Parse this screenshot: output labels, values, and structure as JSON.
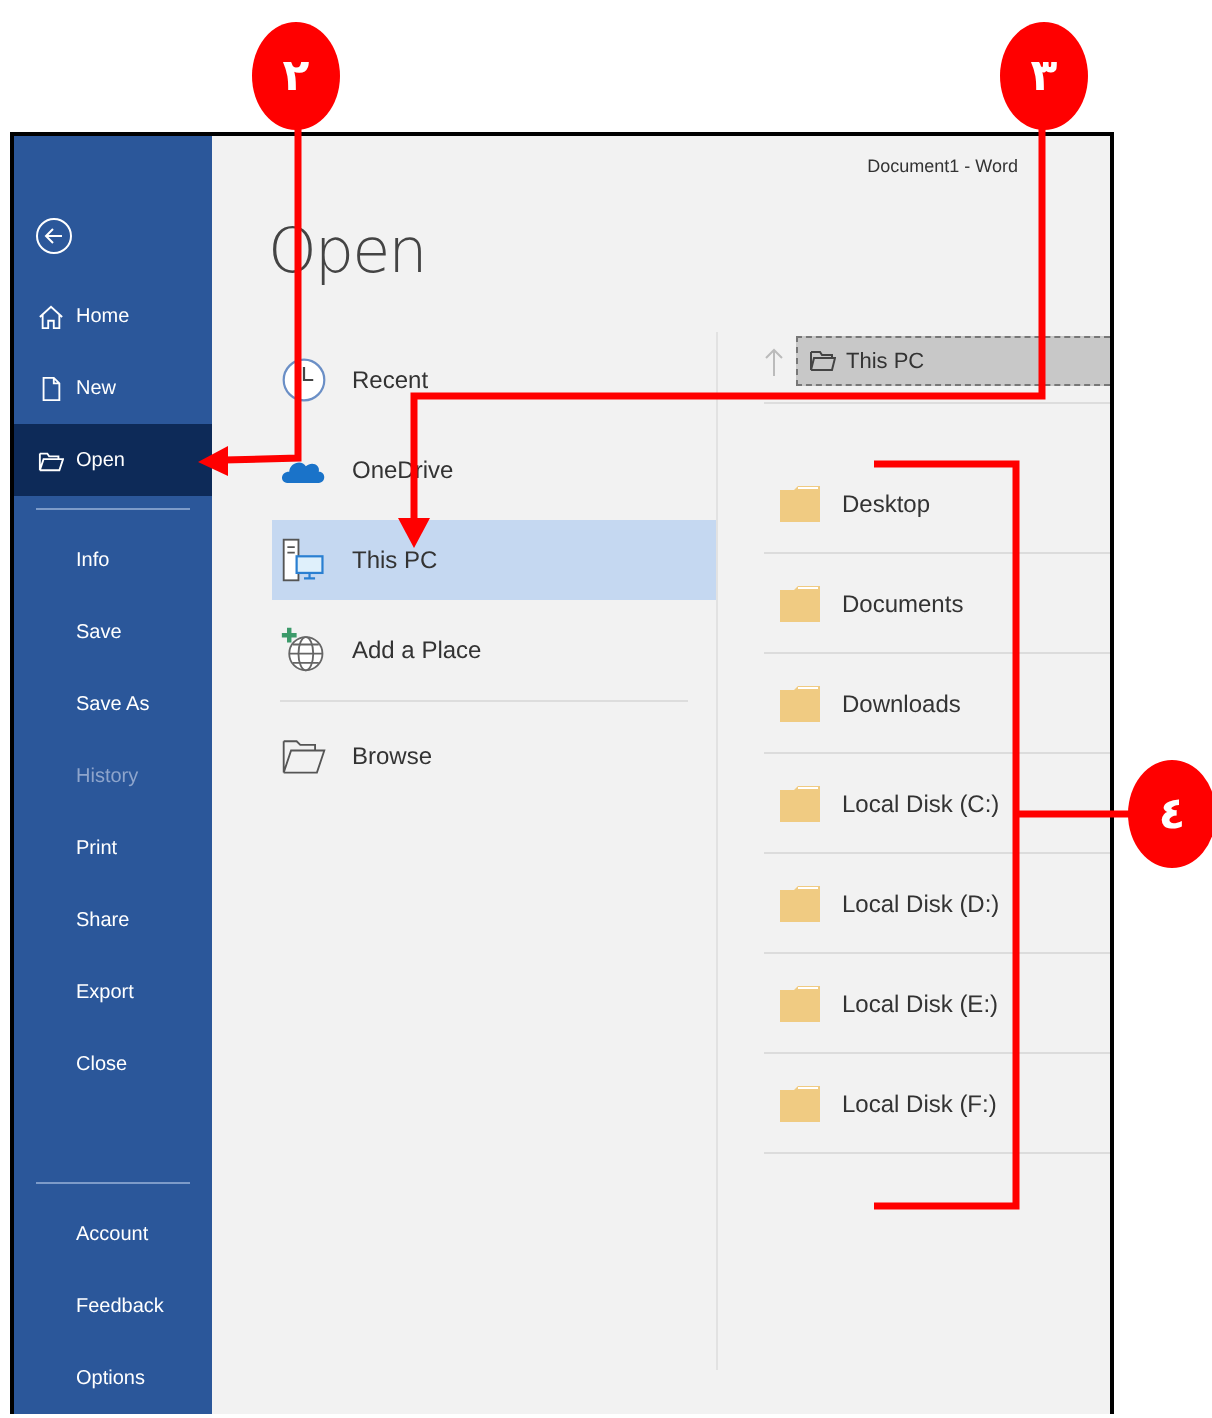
{
  "window": {
    "title": "Document1 - Word"
  },
  "sidebar": {
    "top_items": [
      {
        "label": "Home",
        "kind": "home",
        "selected": false,
        "disabled": false
      },
      {
        "label": "New",
        "kind": "new",
        "selected": false,
        "disabled": false
      },
      {
        "label": "Open",
        "kind": "open",
        "selected": true,
        "disabled": false
      }
    ],
    "middle_items": [
      {
        "label": "Info",
        "kind": "plain",
        "selected": false,
        "disabled": false
      },
      {
        "label": "Save",
        "kind": "plain",
        "selected": false,
        "disabled": false
      },
      {
        "label": "Save As",
        "kind": "plain",
        "selected": false,
        "disabled": false
      },
      {
        "label": "History",
        "kind": "plain",
        "selected": false,
        "disabled": true
      },
      {
        "label": "Print",
        "kind": "plain",
        "selected": false,
        "disabled": false
      },
      {
        "label": "Share",
        "kind": "plain",
        "selected": false,
        "disabled": false
      },
      {
        "label": "Export",
        "kind": "plain",
        "selected": false,
        "disabled": false
      },
      {
        "label": "Close",
        "kind": "plain",
        "selected": false,
        "disabled": false
      }
    ],
    "bottom_items": [
      {
        "label": "Account",
        "kind": "plain",
        "selected": false,
        "disabled": false
      },
      {
        "label": "Feedback",
        "kind": "plain",
        "selected": false,
        "disabled": false
      },
      {
        "label": "Options",
        "kind": "plain",
        "selected": false,
        "disabled": false
      }
    ]
  },
  "heading": "Open",
  "places": [
    {
      "label": "Recent",
      "kind": "recent",
      "selected": false
    },
    {
      "label": "OneDrive",
      "kind": "onedrive",
      "selected": false
    },
    {
      "label": "This PC",
      "kind": "pc",
      "selected": true
    },
    {
      "label": "Add a Place",
      "kind": "addplace",
      "selected": false
    }
  ],
  "browse": {
    "label": "Browse"
  },
  "location": {
    "path": "This PC"
  },
  "folders": [
    {
      "label": "Desktop"
    },
    {
      "label": "Documents"
    },
    {
      "label": "Downloads"
    },
    {
      "label": "Local Disk (C:)"
    },
    {
      "label": "Local Disk (D:)"
    },
    {
      "label": "Local Disk (E:)"
    },
    {
      "label": "Local Disk (F:)"
    }
  ],
  "annotations": [
    {
      "label": "٢"
    },
    {
      "label": "٣"
    },
    {
      "label": "٤"
    }
  ]
}
